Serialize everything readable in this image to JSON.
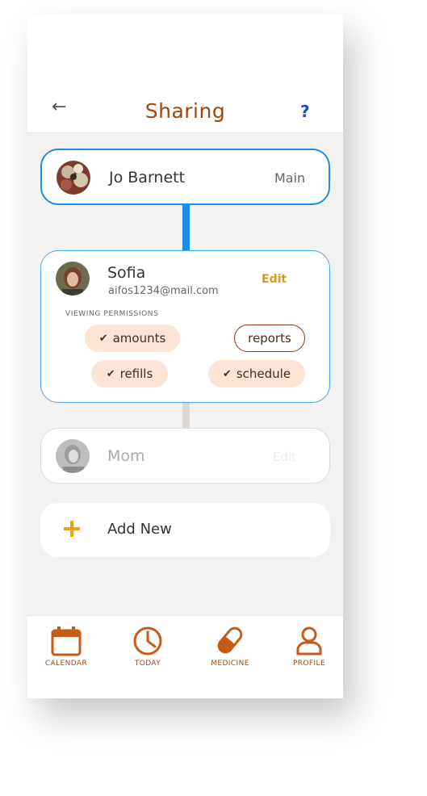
{
  "header": {
    "title": "Sharing",
    "help": "?",
    "back": "←"
  },
  "main_user": {
    "name": "Jo Barnett",
    "role": "Main"
  },
  "sofia": {
    "name": "Sofia",
    "email": "aifos1234@mail.com",
    "edit": "Edit",
    "permissions_title": "VIEWING PERMISSIONS",
    "chips": [
      {
        "label": "amounts",
        "checked": true
      },
      {
        "label": "reports",
        "checked": false
      },
      {
        "label": "refills",
        "checked": true
      },
      {
        "label": "schedule",
        "checked": true
      }
    ]
  },
  "mom": {
    "name": "Mom",
    "edit": "Edit"
  },
  "add_new": {
    "label": "Add New",
    "icon": "plus-icon"
  },
  "nav": [
    {
      "label": "CALENDAR",
      "icon": "calendar-icon"
    },
    {
      "label": "TODAY",
      "icon": "clock-icon"
    },
    {
      "label": "MEDICINE",
      "icon": "pill-icon"
    },
    {
      "label": "PROFILE",
      "icon": "user-icon"
    }
  ],
  "colors": {
    "accent": "#a0470f",
    "blue": "#1a8fe8",
    "chip_bg": "#fde5d6",
    "edit": "#d99a1c"
  }
}
